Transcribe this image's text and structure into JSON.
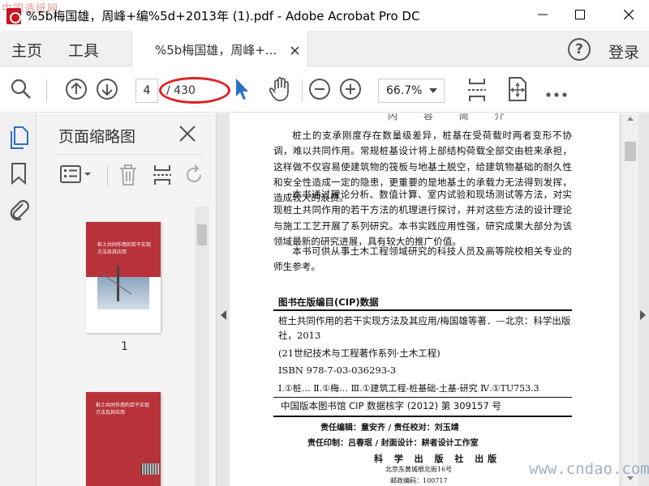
{
  "window": {
    "title": "%5b梅国雄，周峰+编%5d+2013年 (1).pdf - Adobe Acrobat Pro DC",
    "corner_watermark": "中国造纸网"
  },
  "menubar": {
    "home": "主页",
    "tools": "工具",
    "doc_tab": "%5b梅国雄，周峰+...",
    "help": "?",
    "login": "登录"
  },
  "toolbar": {
    "page_current": "4",
    "page_total": "/ 430",
    "zoom": "66.7%"
  },
  "thumbnails_panel": {
    "title": "页面缩略图",
    "page1_label": "1",
    "thumb1_title": "桩土共同作用的若干实现方法及其应用",
    "thumb2_title": "桩土共同作用的若干实现方法及其应用"
  },
  "document": {
    "top_cut": "内 容 简 介",
    "para1": "桩土的支承刚度存在数量级差异，桩基在受荷载时两者变形不协调，难以共同作用。常规桩基设计将上部结构荷载全部交由桩来承担，这样做不仅容易使建筑物的筏板与地基土脱空，给建筑物基础的耐久性和安全性造成一定的隐患，更重要的是地基土的承载力无法得到发挥，造成较大的浪费。",
    "para2": "本书通过理论分析、数值计算、室内试验和现场测试等方法，对实现桩土共同作用的若干方法的机理进行探讨，并对这些方法的设计理论与施工工艺开展了系列研究。本书实践应用性强，研究成果大部分为该领域最新的研究进展，具有较大的推广价值。",
    "para3": "本书可供从事土木工程领域研究的科技人员及高等院校相关专业的师生参考。",
    "cip_heading": "图书在版编目(CIP)数据",
    "cip_line1": "桩土共同作用的若干实现方法及其应用/梅国雄等著．—北京：科学出版社，2013",
    "cip_line2": "(21世纪技术与工程著作系列·土木工程)",
    "cip_isbn": "ISBN 978-7-03-036293-3",
    "cip_class": "Ⅰ.①桩…  Ⅱ.①梅…  Ⅲ.①建筑工程-桩基础-土基-研究  Ⅳ.①TU753.3",
    "cip_number": "中国版本图书馆 CIP 数据核字 (2012) 第 309157 号",
    "credit1": "责任编辑：童安齐 / 责任校对：刘玉靖",
    "credit2": "责任印制：吕春珉 / 封面设计：耕者设计工作室",
    "publisher": "科 学 出 版 社 出版",
    "address": "北京东黄城根北街16号",
    "zip": "邮政编码：100717"
  },
  "site_watermark": "www.cndao.com",
  "colors": {
    "accent_blue": "#2c6fc9",
    "annotation_red": "#e02020",
    "cover_red": "#b8323a"
  }
}
